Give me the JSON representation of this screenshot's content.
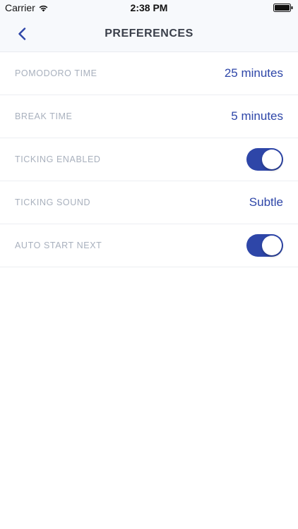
{
  "status_bar": {
    "carrier": "Carrier",
    "time": "2:38 PM",
    "wifi_icon": "wifi-icon",
    "battery_icon": "battery-icon"
  },
  "nav": {
    "title": "PREFERENCES",
    "back_icon": "chevron-left-icon"
  },
  "settings": [
    {
      "label": "POMODORO TIME",
      "value": "25 minutes"
    },
    {
      "label": "BREAK TIME",
      "value": "5 minutes"
    },
    {
      "label": "TICKING ENABLED",
      "toggle_on": true
    },
    {
      "label": "TICKING SOUND",
      "value": "Subtle"
    },
    {
      "label": "AUTO START NEXT",
      "toggle_on": true
    }
  ],
  "colors": {
    "accent": "#2e46a8",
    "label": "#a8b0bd",
    "nav_background": "#f7f9fc"
  }
}
